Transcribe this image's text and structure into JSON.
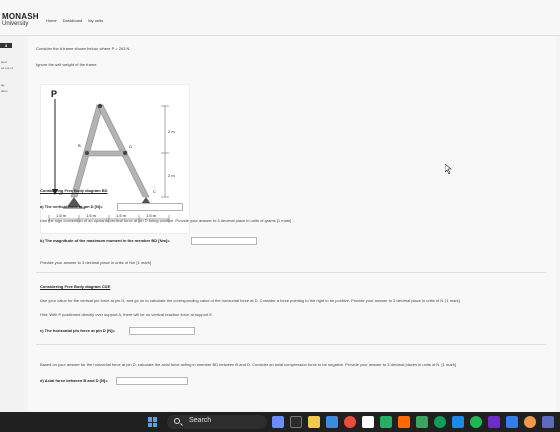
{
  "header": {
    "logo_line1": "MONASH",
    "logo_line2": "University",
    "nav": [
      "Home",
      "Dashboard",
      "My units"
    ]
  },
  "drawer": {
    "badge": "3",
    "line1": "wed",
    "line2": "ed out of",
    "line3": "ag",
    "line4": "ation"
  },
  "question": {
    "intro": "Consider the A frame shown below, where P = 263 N.",
    "ignore": "Ignore the self weight of the frame.",
    "diagram": {
      "load_label": "P",
      "labels": [
        "B",
        "D",
        "A",
        "C"
      ],
      "dims_right": [
        "2 m",
        "2 m"
      ],
      "dims_bottom": [
        "1.5 m",
        "1.5 m",
        "1.5 m",
        "1.5 m"
      ]
    },
    "fbd_bd_heading": "Considering Free Body diagram BD",
    "part_a_label": "a) The vertical force at pin D [N]=",
    "part_a_value": "",
    "sign_note": "Use the sign convention of an upwards vertical force at pin D being positive. Provide your answer to 3 decimal place in units of grams [1 mark]",
    "part_b_label": "b) The magnitude of the maximum moment in the member BD [Nm]=",
    "part_b_value": "",
    "part_b_note": "Provide your answer to 3 decimal place in units of Nm [1 mark]",
    "fbd_cde_heading": "Considering Free Body diagram CDE",
    "cde_note1": "Use your value for the vertical pin force at pin D, and go on to calculate the corresponding value of the horizontal force at D.  Consider a force pointing to the right to be positive.  Provide your answer to 3 decimal place in units of N. [1 mark]",
    "cde_hint": "Hint: With P positioned directly over support A, there will be no vertical reaction force at support E",
    "part_c_label": "c) The horizontal pin force at pin D [N]=",
    "part_c_value": "",
    "axial_note": "Based on your answer for the horizontal force at pin D, calculate the axial force acting in member BD between B and D. Consider an axial compression force to be negative. Provide your answer to 3 decimal places in units of N. [1 mark]",
    "part_d_label": "d) Axial force between B and D [N]=",
    "part_d_value": ""
  },
  "taskbar": {
    "search_label": "Search"
  },
  "colors": {
    "taskbar": "#202020",
    "accent": "#4fa3f7",
    "frame_fill": "#b3b3b3"
  }
}
